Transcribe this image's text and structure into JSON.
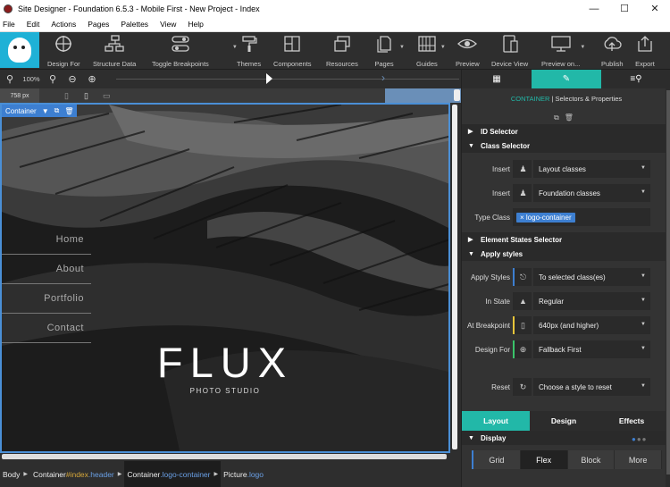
{
  "window": {
    "title": "Site Designer - Foundation 6.5.3 - Mobile First - New Project - Index"
  },
  "menu": [
    "File",
    "Edit",
    "Actions",
    "Pages",
    "Palettes",
    "View",
    "Help"
  ],
  "toolbar": [
    {
      "label": "Design For",
      "icon": "target-icon"
    },
    {
      "label": "Structure Data",
      "icon": "structure-icon"
    },
    {
      "label": "Toggle Breakpoints",
      "icon": "breakpoints-icon"
    },
    {
      "label": "Themes",
      "icon": "paint-roller-icon"
    },
    {
      "label": "Components",
      "icon": "components-icon"
    },
    {
      "label": "Resources",
      "icon": "resources-icon"
    },
    {
      "label": "Pages",
      "icon": "pages-icon"
    },
    {
      "label": "Guides",
      "icon": "guides-icon"
    },
    {
      "label": "Preview",
      "icon": "eye-icon"
    },
    {
      "label": "Device View",
      "icon": "device-icon"
    },
    {
      "label": "Preview on...",
      "icon": "monitor-icon"
    },
    {
      "label": "Publish",
      "icon": "cloud-upload-icon"
    },
    {
      "label": "Export",
      "icon": "export-icon"
    }
  ],
  "zoom": {
    "value": "100%"
  },
  "breakpoint": {
    "width": "758 px"
  },
  "canvas": {
    "container_tag": "Container",
    "nav": [
      "Home",
      "About",
      "Portfolio",
      "Contact"
    ],
    "brand": "FLUX",
    "tagline": "PHOTO STUDIO"
  },
  "breadcrumbs": [
    {
      "a": "Body"
    },
    {
      "a": "Container",
      "b": "#index",
      "c": ".header"
    },
    {
      "a": "Container",
      "c": ".logo-container"
    },
    {
      "a": "Picture",
      "c": ".logo"
    }
  ],
  "panel": {
    "title_type": "CONTAINER",
    "title_rest": " | Selectors & Properties",
    "id_selector": "ID Selector",
    "class_selector": "Class Selector",
    "insert_label": "Insert",
    "layout_classes": "Layout classes",
    "foundation_classes": "Foundation classes",
    "type_class_label": "Type Class",
    "type_class_chip": "logo-container",
    "element_states": "Element States Selector",
    "apply_styles_section": "Apply styles",
    "apply_styles_label": "Apply Styles",
    "apply_styles_value": "To selected class(es)",
    "in_state_label": "In State",
    "in_state_value": "Regular",
    "at_breakpoint_label": "At Breakpoint",
    "at_breakpoint_value": "640px (and higher)",
    "design_for_label": "Design For",
    "design_for_value": "Fallback First",
    "reset_label": "Reset",
    "reset_value": "Choose a style to reset",
    "tabs": [
      "Layout",
      "Design",
      "Effects"
    ],
    "display_section": "Display",
    "display_options": [
      "Grid",
      "Flex",
      "Block",
      "More"
    ]
  },
  "colors": {
    "accent": "#22b8a8",
    "selection": "#3d7fd1"
  }
}
